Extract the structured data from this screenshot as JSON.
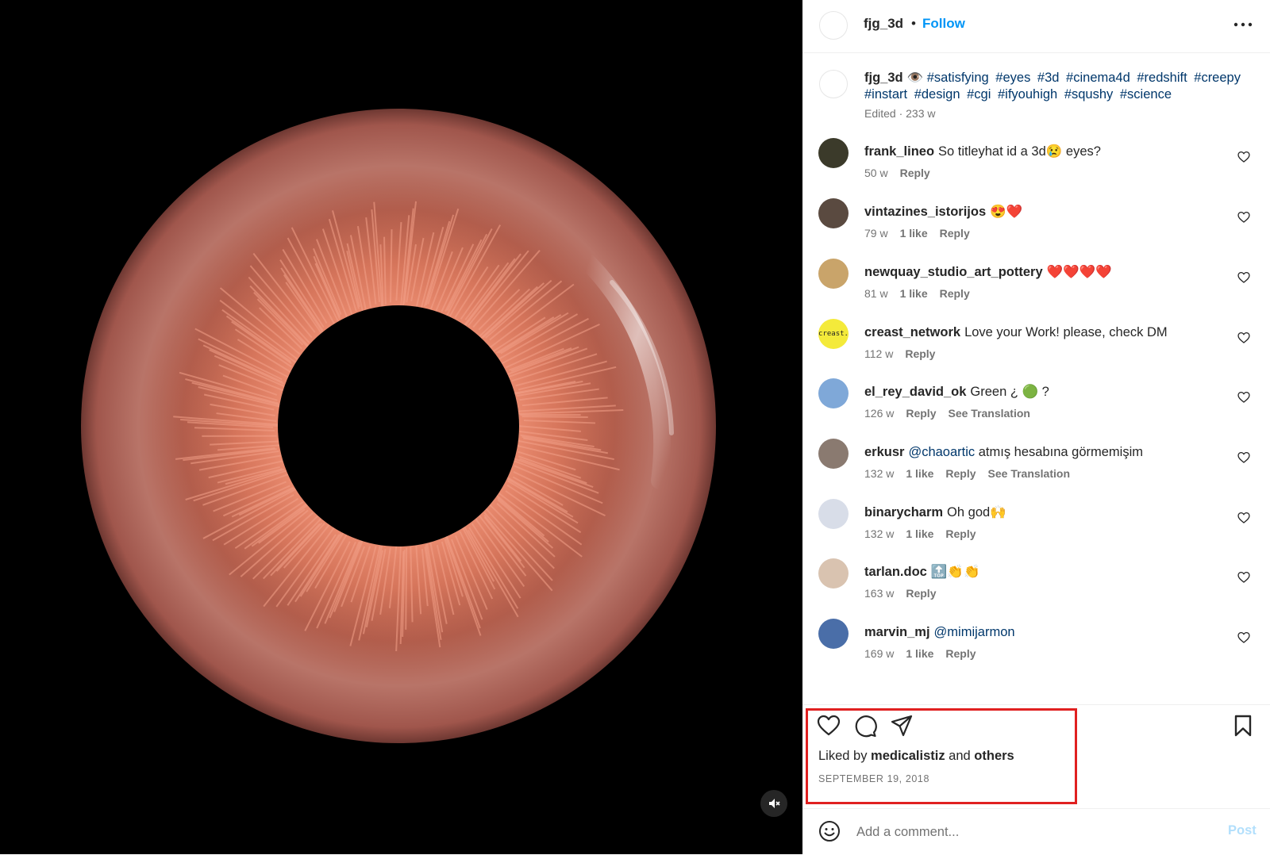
{
  "post": {
    "username": "fjg_3d",
    "separator": "•",
    "follow_label": "Follow",
    "more_icon": "more-horizontal-icon"
  },
  "caption": {
    "username": "fjg_3d",
    "emoji": "👁️",
    "hashtags": [
      "#satisfying",
      "#eyes",
      "#3d",
      "#cinema4d",
      "#redshift",
      "#creepy",
      "#instart",
      "#design",
      "#cgi",
      "#ifyouhigh",
      "#squshy",
      "#science"
    ],
    "meta": "Edited · 233 w"
  },
  "comments": [
    {
      "username": "frank_lineo",
      "text": "So titleyhat id a 3d😢 eyes?",
      "mention": "",
      "time": "50 w",
      "likes": "",
      "reply": "Reply",
      "translation": "",
      "avatar_color": "#3b3a2a"
    },
    {
      "username": "vintazines_istorijos",
      "text": "😍❤️",
      "mention": "",
      "time": "79 w",
      "likes": "1 like",
      "reply": "Reply",
      "translation": "",
      "avatar_color": "#5a4a40"
    },
    {
      "username": "newquay_studio_art_pottery",
      "text": "❤️❤️❤️❤️",
      "mention": "",
      "time": "81 w",
      "likes": "1 like",
      "reply": "Reply",
      "translation": "",
      "avatar_color": "#c9a46a"
    },
    {
      "username": "creast_network",
      "text": "Love your Work! please, check DM",
      "mention": "",
      "time": "112 w",
      "likes": "",
      "reply": "Reply",
      "translation": "",
      "avatar_color": "#f4ea3a",
      "avatar_text": "creast."
    },
    {
      "username": "el_rey_david_ok",
      "text": "Green ¿ 🟢 ?",
      "mention": "",
      "time": "126 w",
      "likes": "",
      "reply": "Reply",
      "translation": "See Translation",
      "avatar_color": "#7fa8d8"
    },
    {
      "username": "erkusr",
      "text": " atmış hesabına görmemişim",
      "mention": "@chaoartic",
      "time": "132 w",
      "likes": "1 like",
      "reply": "Reply",
      "translation": "See Translation",
      "avatar_color": "#8a7a70"
    },
    {
      "username": "binarycharm",
      "text": "Oh god🙌",
      "mention": "",
      "time": "132 w",
      "likes": "1 like",
      "reply": "Reply",
      "translation": "",
      "avatar_color": "#d8dde8"
    },
    {
      "username": "tarlan.doc",
      "text": "🔝👏👏",
      "mention": "",
      "time": "163 w",
      "likes": "",
      "reply": "Reply",
      "translation": "",
      "avatar_color": "#d9c3b0"
    },
    {
      "username": "marvin_mj",
      "text": "",
      "mention": "@mimijarmon",
      "time": "169 w",
      "likes": "1 like",
      "reply": "Reply",
      "translation": "",
      "avatar_color": "#4a6ea8"
    }
  ],
  "actions": {
    "like_icon": "heart-icon",
    "comment_icon": "comment-icon",
    "share_icon": "share-icon",
    "save_icon": "bookmark-icon",
    "liked_prefix": "Liked by ",
    "liked_user": "medicalistiz",
    "liked_middle": " and ",
    "liked_others": "others",
    "date": "SEPTEMBER 19, 2018"
  },
  "add_comment": {
    "placeholder": "Add a comment...",
    "post_label": "Post",
    "emoji_icon": "emoji-icon"
  },
  "media": {
    "mute_icon": "speaker-muted-icon"
  },
  "colors": {
    "accent": "#0095f6",
    "link": "#00376b",
    "highlight": "#e02020",
    "muted": "#737373"
  }
}
